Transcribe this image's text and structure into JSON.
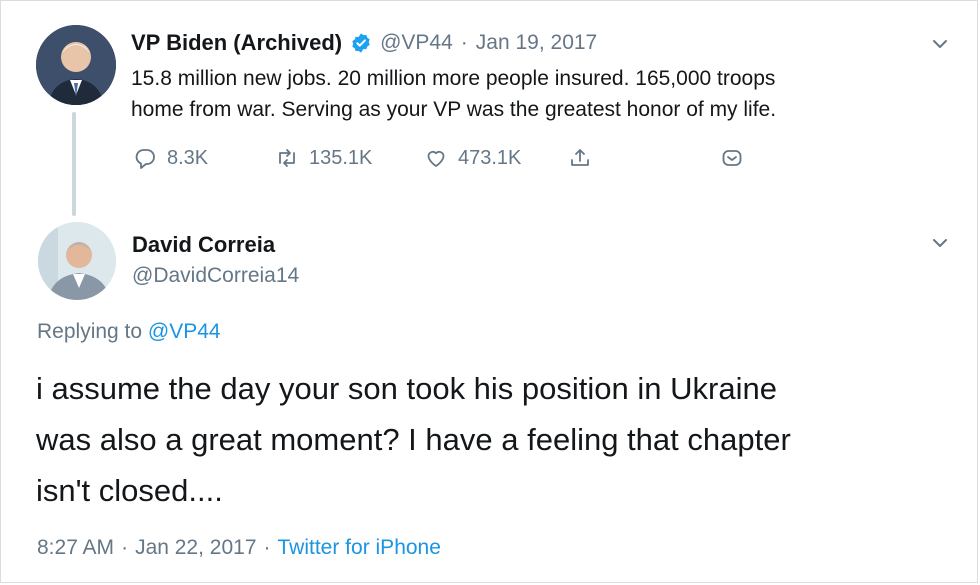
{
  "tweet": {
    "author_name": "VP Biden (Archived)",
    "verified": true,
    "handle": "@VP44",
    "separator": "·",
    "date": "Jan 19, 2017",
    "text_line1": "15.8 million new jobs. 20 million more people insured. 165,000 troops",
    "text_line2": "home from war. Serving as your VP was the greatest honor of my life.",
    "replies": "8.3K",
    "retweets": "135.1K",
    "likes": "473.1K"
  },
  "reply": {
    "author_name": "David Correia",
    "handle": "@DavidCorreia14",
    "replying_prefix": "Replying to",
    "replying_to": "@VP44",
    "text_line1": "i assume the day your son took his position in Ukraine",
    "text_line2": "was also a great moment? I have a feeling that chapter",
    "text_line3": "isn't closed....",
    "time": "8:27 AM",
    "separator": "·",
    "date": "Jan 22, 2017",
    "separator2": "·",
    "source": "Twitter for iPhone"
  },
  "colors": {
    "brand_blue": "#1da1f2",
    "link_blue": "#1b95e0",
    "muted": "#657786",
    "text": "#14171a"
  },
  "icons": [
    "reply-icon",
    "retweet-icon",
    "like-icon",
    "share-icon",
    "dm-icon",
    "chevron-down-icon",
    "verified-badge-icon"
  ]
}
